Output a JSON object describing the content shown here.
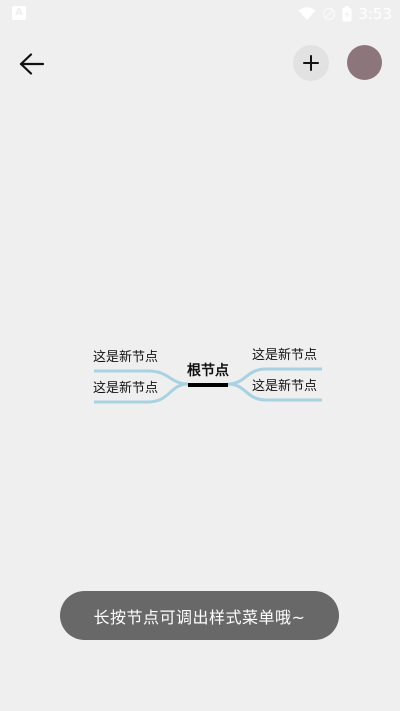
{
  "status_bar": {
    "notification_icon": "A",
    "time": "3:53",
    "icons": [
      "wifi-icon",
      "no-sim-icon",
      "battery-icon"
    ]
  },
  "app_bar": {
    "back_icon": "arrow-left-icon",
    "add_icon": "plus-icon",
    "avatar_color": "#8c767c"
  },
  "mindmap": {
    "root": {
      "label": "根节点"
    },
    "left_children": [
      {
        "label": "这是新节点"
      },
      {
        "label": "这是新节点"
      }
    ],
    "right_children": [
      {
        "label": "这是新节点"
      },
      {
        "label": "这是新节点"
      }
    ],
    "line_color": "#a8d2e2",
    "root_underline_color": "#000000"
  },
  "toast": {
    "text": "长按节点可调出样式菜单哦~"
  }
}
